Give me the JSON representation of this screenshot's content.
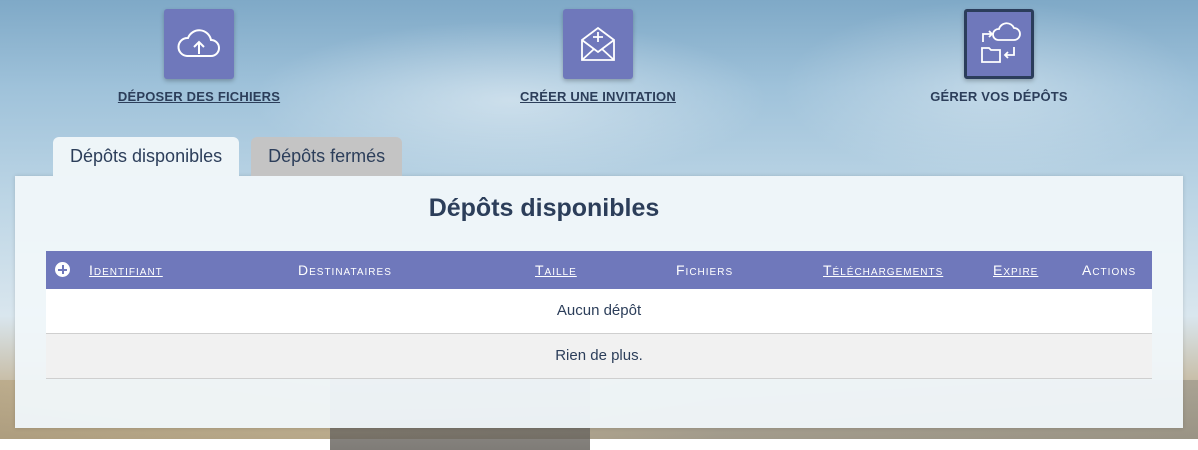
{
  "nav": {
    "upload": {
      "label": "DÉPOSER DES FICHIERS",
      "icon": "cloud-upload-icon"
    },
    "invite": {
      "label": "CRÉER UNE INVITATION",
      "icon": "envelope-plus-icon"
    },
    "manage": {
      "label": "GÉRER VOS DÉPÔTS",
      "icon": "transfer-manage-icon"
    }
  },
  "tabs": [
    {
      "label": "Dépôts disponibles",
      "active": true
    },
    {
      "label": "Dépôts fermés",
      "active": false
    }
  ],
  "panel": {
    "title": "Dépôts disponibles",
    "columns": [
      "Identifiant",
      "Destinataires",
      "Taille",
      "Fichiers",
      "Téléchargements",
      "Expire",
      "Actions"
    ],
    "rows": [
      "Aucun dépôt",
      "Rien de plus."
    ]
  },
  "colors": {
    "accent": "#6f78bb",
    "text": "#2c3e5a"
  }
}
